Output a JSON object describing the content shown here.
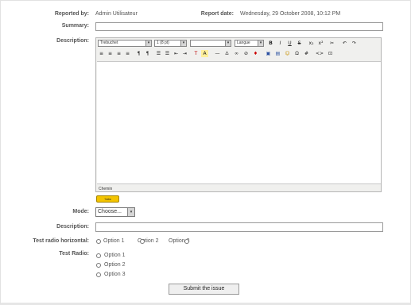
{
  "report": {
    "reported_by_label": "Reported by:",
    "reported_by_value": "Admin Utilisateur",
    "report_date_label": "Report date:",
    "report_date_value": "Wednesday, 29 October 2008, 10:12 PM"
  },
  "summary": {
    "label": "Summary:",
    "value": ""
  },
  "description": {
    "label": "Description:",
    "editor": {
      "font_family": "Trebuchet",
      "font_size": "1 (8 pt)",
      "format": "",
      "language": "Langue",
      "path_label": "Chemin",
      "spell_label": "?abc",
      "toolbar_row1": [
        "B",
        "I",
        "U",
        "S",
        "x₂",
        "x²",
        "✂",
        "↶",
        "↷"
      ],
      "toolbar_row2": [
        "≡",
        "≡",
        "≡",
        "≡",
        "¶",
        "¶",
        "☰",
        "☰",
        "⇤",
        "⇥",
        "T",
        "A",
        "—",
        "⚓",
        "∞",
        "⊘",
        "♦",
        "▣",
        "▤",
        "☺",
        "Ω",
        "#",
        "<>",
        "⊡"
      ]
    }
  },
  "mode": {
    "label": "Mode:",
    "value": "Choose..."
  },
  "description2": {
    "label": "Description:",
    "value": ""
  },
  "radio_horizontal": {
    "label": "Test radio horizontal:",
    "options": [
      "Option 1",
      "Option 2",
      "Option 3"
    ]
  },
  "radio_vertical": {
    "label": "Test Radio:",
    "options": [
      "Option 1",
      "Option 2",
      "Option 3"
    ]
  },
  "submit": {
    "label": "Submit the issue"
  }
}
